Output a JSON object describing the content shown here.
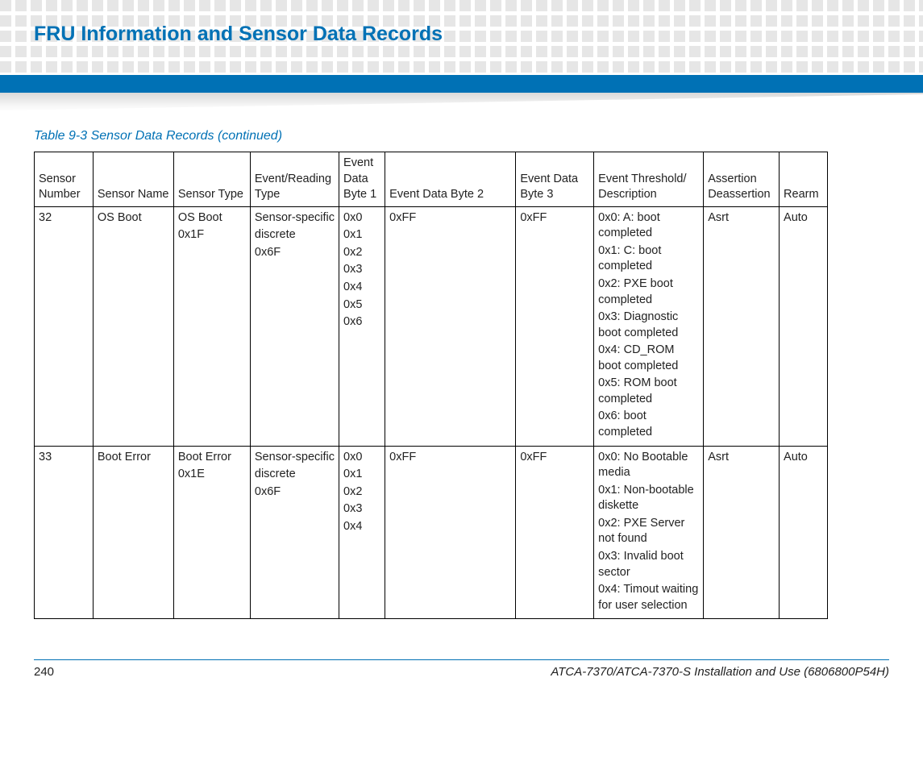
{
  "header": {
    "chapter_title": "FRU Information and Sensor Data Records"
  },
  "table": {
    "caption": "Table 9-3  Sensor Data Records  (continued)",
    "headers": {
      "sensor_number": "Sensor Number",
      "sensor_name": "Sensor Name",
      "sensor_type": "Sensor Type",
      "event_reading_type": "Event/Reading Type",
      "event_data_byte1": "Event Data Byte 1",
      "event_data_byte2": "Event Data Byte 2",
      "event_data_byte3": "Event Data Byte 3",
      "event_threshold_desc": "Event Threshold/ Description",
      "assertion_deassertion": "Assertion Deassertion",
      "rearm": "Rearm"
    },
    "rows": [
      {
        "sensor_number": "32",
        "sensor_name": "OS Boot",
        "sensor_type": [
          "OS Boot",
          "0x1F"
        ],
        "event_reading_type": [
          "Sensor-specific",
          "discrete",
          "0x6F"
        ],
        "event_data_byte1": [
          "0x0",
          "0x1",
          "0x2",
          "0x3",
          "0x4",
          "0x5",
          "0x6"
        ],
        "event_data_byte2": "0xFF",
        "event_data_byte3": "0xFF",
        "event_threshold_desc": [
          "0x0: A: boot completed",
          "0x1: C: boot completed",
          "0x2: PXE boot completed",
          "0x3: Diagnostic boot completed",
          "0x4: CD_ROM boot completed",
          "0x5: ROM boot completed",
          "0x6: boot completed"
        ],
        "assertion_deassertion": "Asrt",
        "rearm": "Auto"
      },
      {
        "sensor_number": "33",
        "sensor_name": " Boot Error",
        "sensor_type": [
          "Boot Error",
          "0x1E"
        ],
        "event_reading_type": [
          "Sensor-specific",
          "discrete",
          "0x6F"
        ],
        "event_data_byte1": [
          "0x0",
          "0x1",
          "0x2",
          "0x3",
          "0x4"
        ],
        "event_data_byte2": "0xFF",
        "event_data_byte3": "0xFF",
        "event_threshold_desc": [
          "0x0: No Bootable media",
          "0x1: Non-bootable diskette",
          "0x2: PXE Server not found",
          "0x3: Invalid boot sector",
          "0x4: Timout waiting for user selection"
        ],
        "assertion_deassertion": "Asrt",
        "rearm": "Auto"
      }
    ]
  },
  "footer": {
    "page_number": "240",
    "doc_title": "ATCA-7370/ATCA-7370-S Installation and Use (6806800P54H)"
  }
}
